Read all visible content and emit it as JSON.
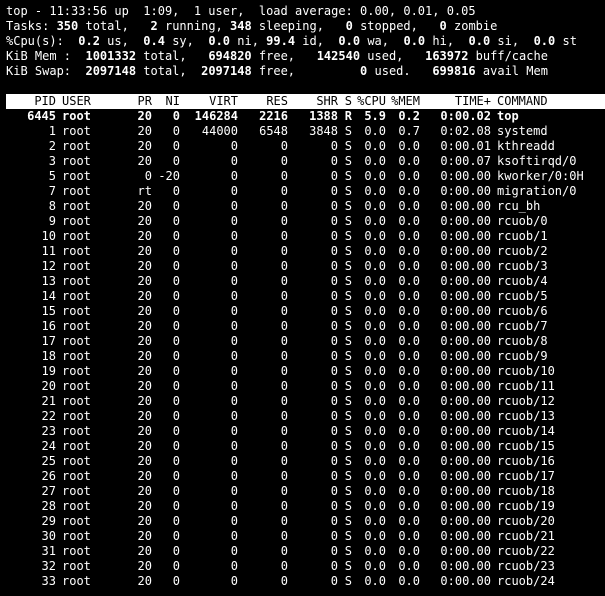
{
  "summary": {
    "line1": "top - 11:33:56 up  1:09,  1 user,  load average: 0.00, 0.01, 0.05",
    "tasks": {
      "label": "Tasks: ",
      "total": "350",
      "total_label": " total,   ",
      "running": "2",
      "running_label": " running, ",
      "sleeping": "348",
      "sleeping_label": " sleeping,   ",
      "stopped": "0",
      "stopped_label": " stopped,   ",
      "zombie": "0",
      "zombie_label": " zombie"
    },
    "cpu": {
      "label": "%Cpu(s):  ",
      "us": "0.2",
      "us_label": " us,  ",
      "sy": "0.4",
      "sy_label": " sy,  ",
      "ni": "0.0",
      "ni_label": " ni, ",
      "id": "99.4",
      "id_label": " id,  ",
      "wa": "0.0",
      "wa_label": " wa,  ",
      "hi": "0.0",
      "hi_label": " hi,  ",
      "si": "0.0",
      "si_label": " si,  ",
      "st": "0.0",
      "st_label": " st"
    },
    "mem": {
      "label": "KiB Mem :  ",
      "total": "1001332",
      "total_label": " total,   ",
      "free": "694820",
      "free_label": " free,   ",
      "used": "142540",
      "used_label": " used,   ",
      "cache": "163972",
      "cache_label": " buff/cache"
    },
    "swap": {
      "label": "KiB Swap:  ",
      "total": "2097148",
      "total_label": " total,  ",
      "free": "2097148",
      "free_label": " free,         ",
      "used": "0",
      "used_label": " used.   ",
      "avail": "699816",
      "avail_label": " avail Mem"
    }
  },
  "columns": {
    "pid": "PID",
    "user": "USER",
    "pr": "PR",
    "ni": "NI",
    "virt": "VIRT",
    "res": "RES",
    "shr": "SHR",
    "s": "S",
    "cpu": "%CPU",
    "mem": "%MEM",
    "time": "TIME+",
    "command": "COMMAND"
  },
  "processes": [
    {
      "pid": "6445",
      "user": "root",
      "pr": "20",
      "ni": "0",
      "virt": "146284",
      "res": "2216",
      "shr": "1388",
      "s": "R",
      "cpu": "5.9",
      "mem": "0.2",
      "time": "0:00.02",
      "command": "top",
      "active": true
    },
    {
      "pid": "1",
      "user": "root",
      "pr": "20",
      "ni": "0",
      "virt": "44000",
      "res": "6548",
      "shr": "3848",
      "s": "S",
      "cpu": "0.0",
      "mem": "0.7",
      "time": "0:02.08",
      "command": "systemd",
      "active": false
    },
    {
      "pid": "2",
      "user": "root",
      "pr": "20",
      "ni": "0",
      "virt": "0",
      "res": "0",
      "shr": "0",
      "s": "S",
      "cpu": "0.0",
      "mem": "0.0",
      "time": "0:00.01",
      "command": "kthreadd",
      "active": false
    },
    {
      "pid": "3",
      "user": "root",
      "pr": "20",
      "ni": "0",
      "virt": "0",
      "res": "0",
      "shr": "0",
      "s": "S",
      "cpu": "0.0",
      "mem": "0.0",
      "time": "0:00.07",
      "command": "ksoftirqd/0",
      "active": false
    },
    {
      "pid": "5",
      "user": "root",
      "pr": "0",
      "ni": "-20",
      "virt": "0",
      "res": "0",
      "shr": "0",
      "s": "S",
      "cpu": "0.0",
      "mem": "0.0",
      "time": "0:00.00",
      "command": "kworker/0:0H",
      "active": false
    },
    {
      "pid": "7",
      "user": "root",
      "pr": "rt",
      "ni": "0",
      "virt": "0",
      "res": "0",
      "shr": "0",
      "s": "S",
      "cpu": "0.0",
      "mem": "0.0",
      "time": "0:00.00",
      "command": "migration/0",
      "active": false
    },
    {
      "pid": "8",
      "user": "root",
      "pr": "20",
      "ni": "0",
      "virt": "0",
      "res": "0",
      "shr": "0",
      "s": "S",
      "cpu": "0.0",
      "mem": "0.0",
      "time": "0:00.00",
      "command": "rcu_bh",
      "active": false
    },
    {
      "pid": "9",
      "user": "root",
      "pr": "20",
      "ni": "0",
      "virt": "0",
      "res": "0",
      "shr": "0",
      "s": "S",
      "cpu": "0.0",
      "mem": "0.0",
      "time": "0:00.00",
      "command": "rcuob/0",
      "active": false
    },
    {
      "pid": "10",
      "user": "root",
      "pr": "20",
      "ni": "0",
      "virt": "0",
      "res": "0",
      "shr": "0",
      "s": "S",
      "cpu": "0.0",
      "mem": "0.0",
      "time": "0:00.00",
      "command": "rcuob/1",
      "active": false
    },
    {
      "pid": "11",
      "user": "root",
      "pr": "20",
      "ni": "0",
      "virt": "0",
      "res": "0",
      "shr": "0",
      "s": "S",
      "cpu": "0.0",
      "mem": "0.0",
      "time": "0:00.00",
      "command": "rcuob/2",
      "active": false
    },
    {
      "pid": "12",
      "user": "root",
      "pr": "20",
      "ni": "0",
      "virt": "0",
      "res": "0",
      "shr": "0",
      "s": "S",
      "cpu": "0.0",
      "mem": "0.0",
      "time": "0:00.00",
      "command": "rcuob/3",
      "active": false
    },
    {
      "pid": "13",
      "user": "root",
      "pr": "20",
      "ni": "0",
      "virt": "0",
      "res": "0",
      "shr": "0",
      "s": "S",
      "cpu": "0.0",
      "mem": "0.0",
      "time": "0:00.00",
      "command": "rcuob/4",
      "active": false
    },
    {
      "pid": "14",
      "user": "root",
      "pr": "20",
      "ni": "0",
      "virt": "0",
      "res": "0",
      "shr": "0",
      "s": "S",
      "cpu": "0.0",
      "mem": "0.0",
      "time": "0:00.00",
      "command": "rcuob/5",
      "active": false
    },
    {
      "pid": "15",
      "user": "root",
      "pr": "20",
      "ni": "0",
      "virt": "0",
      "res": "0",
      "shr": "0",
      "s": "S",
      "cpu": "0.0",
      "mem": "0.0",
      "time": "0:00.00",
      "command": "rcuob/6",
      "active": false
    },
    {
      "pid": "16",
      "user": "root",
      "pr": "20",
      "ni": "0",
      "virt": "0",
      "res": "0",
      "shr": "0",
      "s": "S",
      "cpu": "0.0",
      "mem": "0.0",
      "time": "0:00.00",
      "command": "rcuob/7",
      "active": false
    },
    {
      "pid": "17",
      "user": "root",
      "pr": "20",
      "ni": "0",
      "virt": "0",
      "res": "0",
      "shr": "0",
      "s": "S",
      "cpu": "0.0",
      "mem": "0.0",
      "time": "0:00.00",
      "command": "rcuob/8",
      "active": false
    },
    {
      "pid": "18",
      "user": "root",
      "pr": "20",
      "ni": "0",
      "virt": "0",
      "res": "0",
      "shr": "0",
      "s": "S",
      "cpu": "0.0",
      "mem": "0.0",
      "time": "0:00.00",
      "command": "rcuob/9",
      "active": false
    },
    {
      "pid": "19",
      "user": "root",
      "pr": "20",
      "ni": "0",
      "virt": "0",
      "res": "0",
      "shr": "0",
      "s": "S",
      "cpu": "0.0",
      "mem": "0.0",
      "time": "0:00.00",
      "command": "rcuob/10",
      "active": false
    },
    {
      "pid": "20",
      "user": "root",
      "pr": "20",
      "ni": "0",
      "virt": "0",
      "res": "0",
      "shr": "0",
      "s": "S",
      "cpu": "0.0",
      "mem": "0.0",
      "time": "0:00.00",
      "command": "rcuob/11",
      "active": false
    },
    {
      "pid": "21",
      "user": "root",
      "pr": "20",
      "ni": "0",
      "virt": "0",
      "res": "0",
      "shr": "0",
      "s": "S",
      "cpu": "0.0",
      "mem": "0.0",
      "time": "0:00.00",
      "command": "rcuob/12",
      "active": false
    },
    {
      "pid": "22",
      "user": "root",
      "pr": "20",
      "ni": "0",
      "virt": "0",
      "res": "0",
      "shr": "0",
      "s": "S",
      "cpu": "0.0",
      "mem": "0.0",
      "time": "0:00.00",
      "command": "rcuob/13",
      "active": false
    },
    {
      "pid": "23",
      "user": "root",
      "pr": "20",
      "ni": "0",
      "virt": "0",
      "res": "0",
      "shr": "0",
      "s": "S",
      "cpu": "0.0",
      "mem": "0.0",
      "time": "0:00.00",
      "command": "rcuob/14",
      "active": false
    },
    {
      "pid": "24",
      "user": "root",
      "pr": "20",
      "ni": "0",
      "virt": "0",
      "res": "0",
      "shr": "0",
      "s": "S",
      "cpu": "0.0",
      "mem": "0.0",
      "time": "0:00.00",
      "command": "rcuob/15",
      "active": false
    },
    {
      "pid": "25",
      "user": "root",
      "pr": "20",
      "ni": "0",
      "virt": "0",
      "res": "0",
      "shr": "0",
      "s": "S",
      "cpu": "0.0",
      "mem": "0.0",
      "time": "0:00.00",
      "command": "rcuob/16",
      "active": false
    },
    {
      "pid": "26",
      "user": "root",
      "pr": "20",
      "ni": "0",
      "virt": "0",
      "res": "0",
      "shr": "0",
      "s": "S",
      "cpu": "0.0",
      "mem": "0.0",
      "time": "0:00.00",
      "command": "rcuob/17",
      "active": false
    },
    {
      "pid": "27",
      "user": "root",
      "pr": "20",
      "ni": "0",
      "virt": "0",
      "res": "0",
      "shr": "0",
      "s": "S",
      "cpu": "0.0",
      "mem": "0.0",
      "time": "0:00.00",
      "command": "rcuob/18",
      "active": false
    },
    {
      "pid": "28",
      "user": "root",
      "pr": "20",
      "ni": "0",
      "virt": "0",
      "res": "0",
      "shr": "0",
      "s": "S",
      "cpu": "0.0",
      "mem": "0.0",
      "time": "0:00.00",
      "command": "rcuob/19",
      "active": false
    },
    {
      "pid": "29",
      "user": "root",
      "pr": "20",
      "ni": "0",
      "virt": "0",
      "res": "0",
      "shr": "0",
      "s": "S",
      "cpu": "0.0",
      "mem": "0.0",
      "time": "0:00.00",
      "command": "rcuob/20",
      "active": false
    },
    {
      "pid": "30",
      "user": "root",
      "pr": "20",
      "ni": "0",
      "virt": "0",
      "res": "0",
      "shr": "0",
      "s": "S",
      "cpu": "0.0",
      "mem": "0.0",
      "time": "0:00.00",
      "command": "rcuob/21",
      "active": false
    },
    {
      "pid": "31",
      "user": "root",
      "pr": "20",
      "ni": "0",
      "virt": "0",
      "res": "0",
      "shr": "0",
      "s": "S",
      "cpu": "0.0",
      "mem": "0.0",
      "time": "0:00.00",
      "command": "rcuob/22",
      "active": false
    },
    {
      "pid": "32",
      "user": "root",
      "pr": "20",
      "ni": "0",
      "virt": "0",
      "res": "0",
      "shr": "0",
      "s": "S",
      "cpu": "0.0",
      "mem": "0.0",
      "time": "0:00.00",
      "command": "rcuob/23",
      "active": false
    },
    {
      "pid": "33",
      "user": "root",
      "pr": "20",
      "ni": "0",
      "virt": "0",
      "res": "0",
      "shr": "0",
      "s": "S",
      "cpu": "0.0",
      "mem": "0.0",
      "time": "0:00.00",
      "command": "rcuob/24",
      "active": false
    }
  ]
}
